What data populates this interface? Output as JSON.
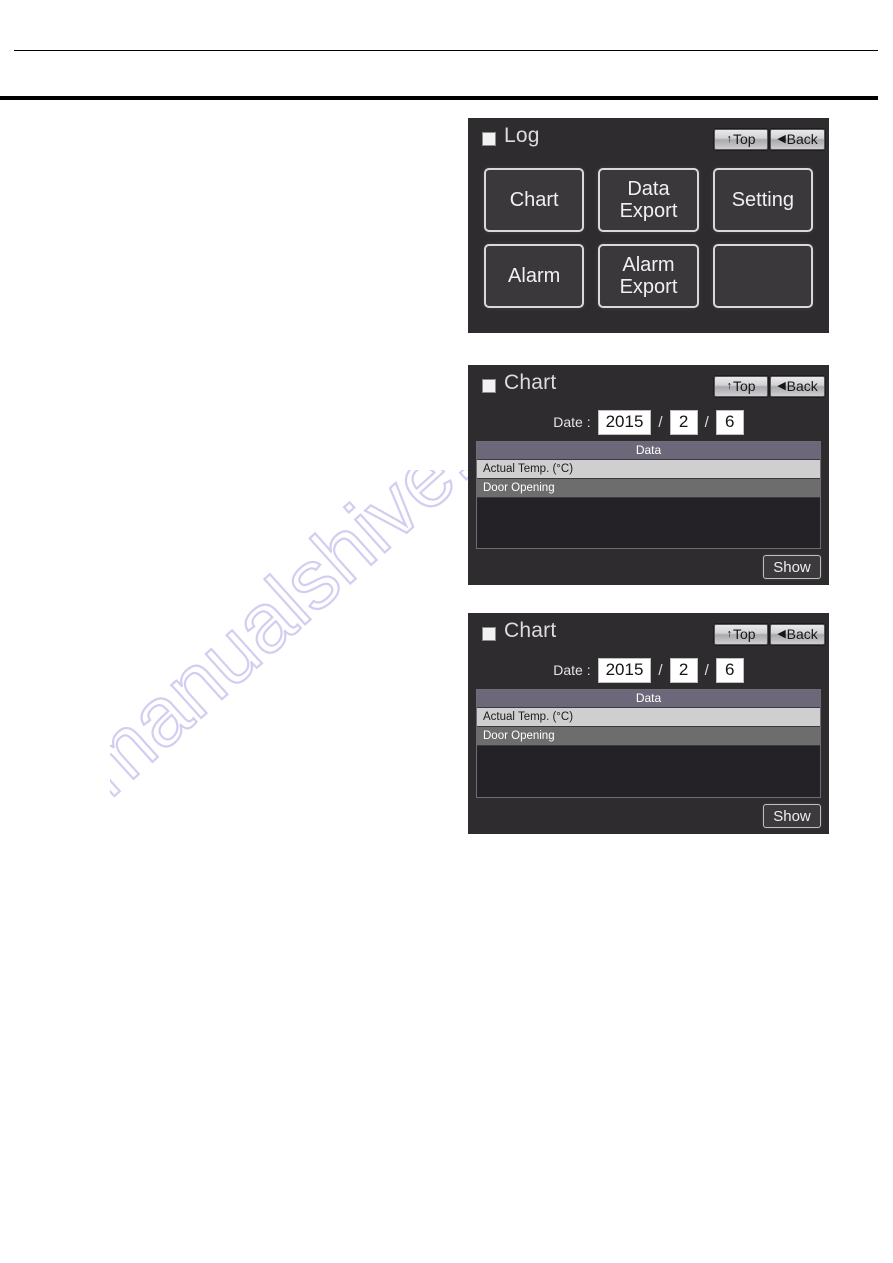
{
  "page": {
    "background": "#ffffff",
    "rule_color": "#000000"
  },
  "watermark": {
    "text": "manualshive.com",
    "color": "#c9c6ef"
  },
  "panels": [
    {
      "id": "log-menu",
      "title": "Log",
      "title_icon": "filled-square-icon",
      "nav": {
        "top_label": "Top",
        "top_glyph": "↑",
        "back_label": "Back",
        "back_glyph": "◀"
      },
      "menu_buttons": [
        {
          "label": "Chart",
          "empty": false
        },
        {
          "label": "Data\nExport",
          "empty": false
        },
        {
          "label": "Setting",
          "empty": false
        },
        {
          "label": "Alarm",
          "empty": false
        },
        {
          "label": "Alarm\nExport",
          "empty": false
        },
        {
          "label": "",
          "empty": true
        }
      ]
    },
    {
      "id": "chart-select-1",
      "title": "Chart",
      "title_icon": "filled-square-icon",
      "nav": {
        "top_label": "Top",
        "top_glyph": "↑",
        "back_label": "Back",
        "back_glyph": "◀"
      },
      "date": {
        "label": "Date :",
        "year": "2015",
        "month": "2",
        "day": "6",
        "separator": "/"
      },
      "table": {
        "header": "Data",
        "rows": [
          {
            "label": "Actual Temp. (°C)",
            "state": "selected"
          },
          {
            "label": "Door Opening",
            "state": "normal"
          }
        ]
      },
      "show_label": "Show"
    },
    {
      "id": "chart-select-2",
      "title": "Chart",
      "title_icon": "filled-square-icon",
      "nav": {
        "top_label": "Top",
        "top_glyph": "↑",
        "back_label": "Back",
        "back_glyph": "◀"
      },
      "date": {
        "label": "Date :",
        "year": "2015",
        "month": "2",
        "day": "6",
        "separator": "/"
      },
      "table": {
        "header": "Data",
        "rows": [
          {
            "label": "Actual Temp. (°C)",
            "state": "selected"
          },
          {
            "label": "Door Opening",
            "state": "normal"
          }
        ]
      },
      "show_label": "Show"
    }
  ]
}
